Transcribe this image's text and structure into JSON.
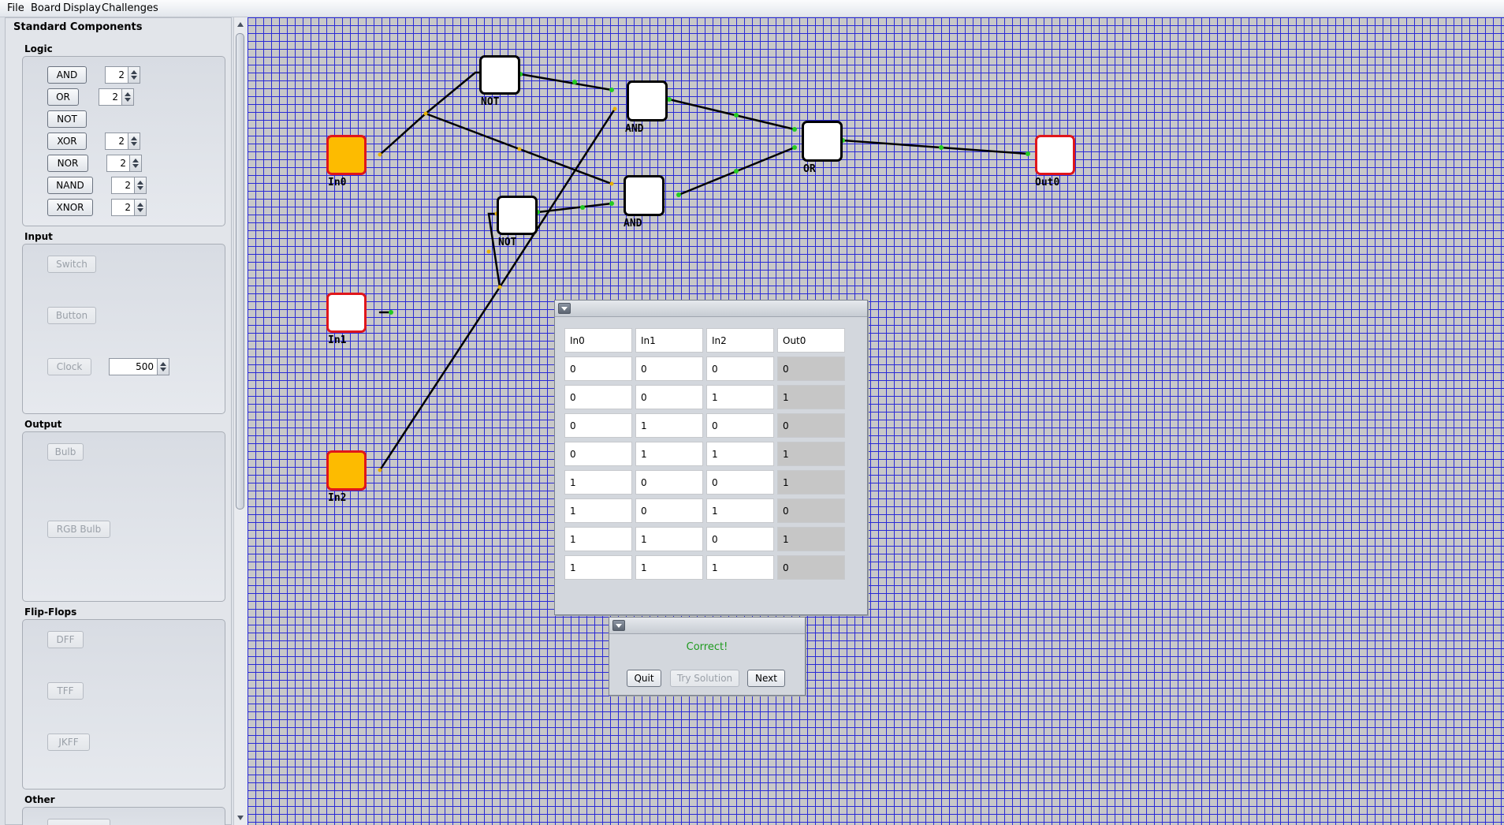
{
  "menu": [
    "File",
    "Board",
    "Display",
    "Challenges"
  ],
  "sidebar": {
    "title": "Standard Components",
    "sections": {
      "logic": {
        "label": "Logic",
        "gates": [
          {
            "label": "AND",
            "inputs": "2"
          },
          {
            "label": "OR",
            "inputs": "2"
          },
          {
            "label": "NOT"
          },
          {
            "label": "XOR",
            "inputs": "2"
          },
          {
            "label": "NOR",
            "inputs": "2"
          },
          {
            "label": "NAND",
            "inputs": "2"
          },
          {
            "label": "XNOR",
            "inputs": "2"
          }
        ]
      },
      "input": {
        "label": "Input",
        "switch": "Switch",
        "button": "Button",
        "clock": "Clock",
        "clock_value": "500"
      },
      "output": {
        "label": "Output",
        "bulb": "Bulb",
        "rgb_bulb": "RGB Bulb"
      },
      "flipflops": {
        "label": "Flip-Flops",
        "dff": "DFF",
        "tff": "TFF",
        "jkff": "JKFF"
      },
      "other": {
        "label": "Other"
      }
    }
  },
  "board": {
    "inputs": [
      {
        "label": "In0",
        "state": "on"
      },
      {
        "label": "In1",
        "state": "off"
      },
      {
        "label": "In2",
        "state": "on"
      }
    ],
    "gates": [
      "NOT",
      "AND",
      "OR",
      "NOT",
      "AND"
    ],
    "output": {
      "label": "Out0",
      "state": "off"
    },
    "colors": {
      "on_fill": "#fdbb00",
      "io_border": "#e0161a",
      "grid": "#2a2ad6",
      "wire": "#000000"
    }
  },
  "truth_table": {
    "headers": [
      "In0",
      "In1",
      "In2",
      "Out0"
    ],
    "rows": [
      [
        "0",
        "0",
        "0",
        "0"
      ],
      [
        "0",
        "0",
        "1",
        "1"
      ],
      [
        "0",
        "1",
        "0",
        "0"
      ],
      [
        "0",
        "1",
        "1",
        "1"
      ],
      [
        "1",
        "0",
        "0",
        "1"
      ],
      [
        "1",
        "0",
        "1",
        "0"
      ],
      [
        "1",
        "1",
        "0",
        "1"
      ],
      [
        "1",
        "1",
        "1",
        "0"
      ]
    ]
  },
  "result_dialog": {
    "message": "Correct!",
    "message_color": "#1f9a1f",
    "quit": "Quit",
    "try_solution": "Try Solution",
    "next": "Next"
  }
}
